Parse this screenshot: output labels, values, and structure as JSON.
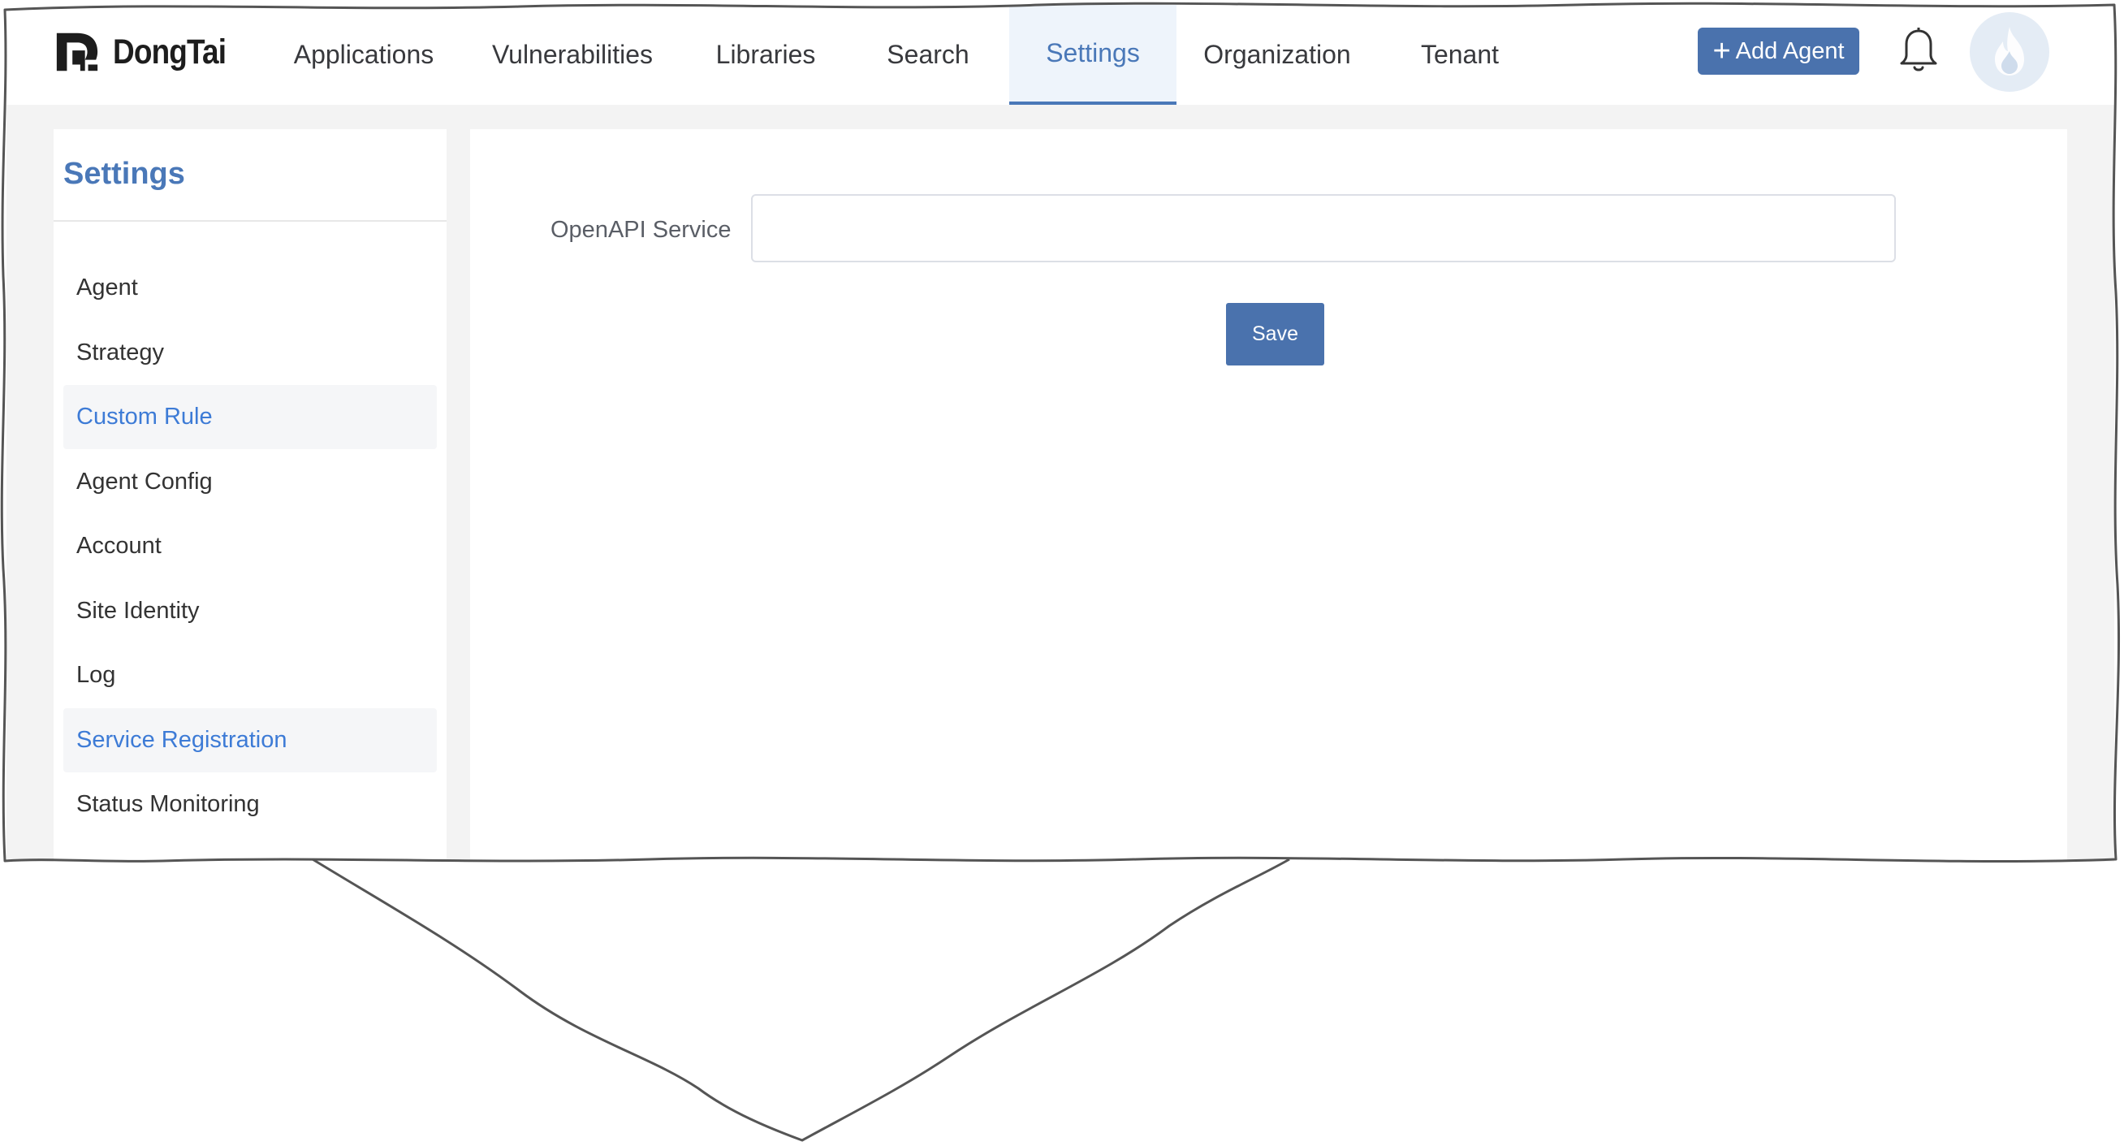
{
  "brand": {
    "name": "DongTai"
  },
  "nav": {
    "tabs": [
      {
        "label": "Applications"
      },
      {
        "label": "Vulnerabilities"
      },
      {
        "label": "Libraries"
      },
      {
        "label": "Search"
      },
      {
        "label": "Settings",
        "active": true
      },
      {
        "label": "Organization"
      },
      {
        "label": "Tenant"
      }
    ],
    "add_agent_label": "Add Agent",
    "add_agent_icon": "plus-icon",
    "notification_icon": "bell-icon",
    "avatar_icon": "flame-icon"
  },
  "sidebar": {
    "title": "Settings",
    "items": [
      {
        "label": "Agent",
        "active": false
      },
      {
        "label": "Strategy",
        "active": false
      },
      {
        "label": "Custom Rule",
        "active": true
      },
      {
        "label": "Agent Config",
        "active": false
      },
      {
        "label": "Account",
        "active": false
      },
      {
        "label": "Site Identity",
        "active": false
      },
      {
        "label": "Log",
        "active": false
      },
      {
        "label": "Service Registration",
        "active": true
      },
      {
        "label": "Status Monitoring",
        "active": false
      }
    ]
  },
  "form": {
    "field_label": "OpenAPI Service",
    "field_value": "",
    "save_label": "Save"
  },
  "colors": {
    "accent": "#4a78b8",
    "button": "#4a72ad",
    "active_link": "#3d7bd6",
    "page_bg": "#f3f3f3",
    "text": "#333333"
  }
}
